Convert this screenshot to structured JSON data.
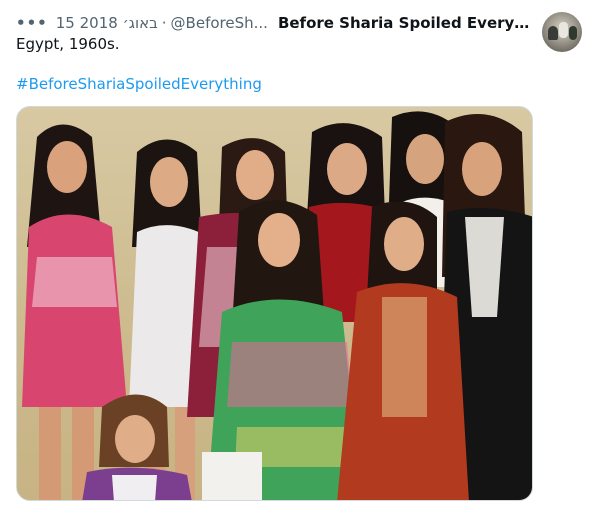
{
  "tweet": {
    "more_label": "•••",
    "date": "15 2018 באוג׳",
    "separator": "·",
    "handle": "@BeforeSh...",
    "display_name": "Before Sharia Spoiled Everyth...",
    "text": "Egypt, 1960s.",
    "hashtag": "#BeforeShariaSpoiledEverything",
    "link_color": "#1d9bf0"
  },
  "icons": {
    "more": "more-horizontal-icon"
  }
}
